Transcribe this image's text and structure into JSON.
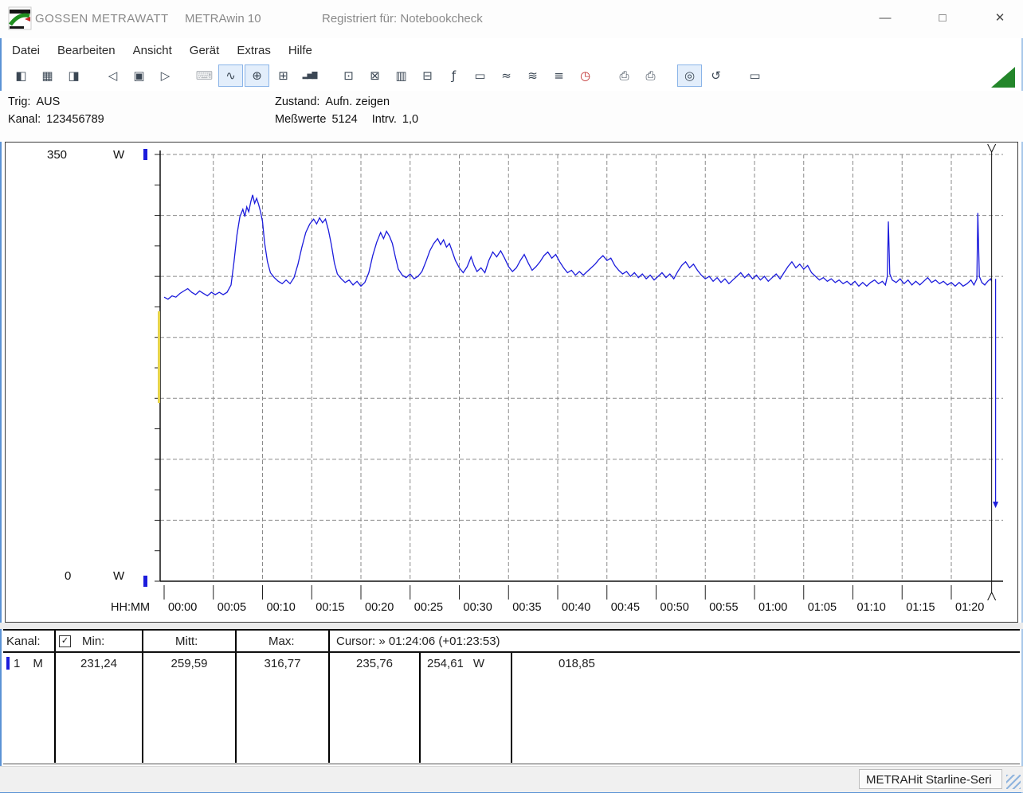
{
  "window": {
    "brand": "GOSSEN METRAWATT",
    "app": "METRAwin 10",
    "registration": "Registriert für: Notebookcheck",
    "controls": {
      "minimize": "—",
      "maximize": "□",
      "close": "✕"
    }
  },
  "menu": {
    "items": [
      {
        "id": "datei",
        "label": "Datei"
      },
      {
        "id": "bearbeiten",
        "label": "Bearbeiten"
      },
      {
        "id": "ansicht",
        "label": "Ansicht"
      },
      {
        "id": "geraet",
        "label": "Gerät"
      },
      {
        "id": "extras",
        "label": "Extras"
      },
      {
        "id": "hilfe",
        "label": "Hilfe"
      }
    ]
  },
  "toolbar": {
    "groups": [
      [
        {
          "name": "open-measurement-button",
          "icon": "disk-import-icon",
          "glyph": "◧"
        },
        {
          "name": "save-measurement-button",
          "icon": "disk-save-icon",
          "glyph": "▦"
        },
        {
          "name": "open-file-button",
          "icon": "folder-open-icon",
          "glyph": "◨"
        }
      ],
      [
        {
          "name": "window-back-button",
          "icon": "window-arrow-left-icon",
          "glyph": "◁"
        },
        {
          "name": "window-copy-button",
          "icon": "window-icon",
          "glyph": "▣"
        },
        {
          "name": "window-forward-button",
          "icon": "window-arrow-right-icon",
          "glyph": "▷"
        }
      ],
      [
        {
          "name": "keyboard-entry-button",
          "icon": "keyboard-icon",
          "glyph": "⌨",
          "disabled": true
        },
        {
          "name": "yt-chart-button",
          "icon": "line-chart-icon",
          "glyph": "∿",
          "pressed": true
        },
        {
          "name": "xy-chart-button",
          "icon": "crosshair-chart-icon",
          "glyph": "⊕",
          "pressed": true
        },
        {
          "name": "table-view-button",
          "icon": "table-icon",
          "glyph": "⊞"
        },
        {
          "name": "histogram-view-button",
          "icon": "bar-chart-icon",
          "glyph": "▂▅▇",
          "small": true
        }
      ],
      [
        {
          "name": "device-connect-button",
          "icon": "monitor-icon",
          "glyph": "⊡"
        },
        {
          "name": "device-readout-button",
          "icon": "monitor-arrow-icon",
          "glyph": "⊠"
        },
        {
          "name": "digital-display-button",
          "icon": "seven-segment-icon",
          "glyph": "▥"
        },
        {
          "name": "monitor-curve-button",
          "icon": "monitor-wave-icon",
          "glyph": "⊟"
        },
        {
          "name": "formula-button",
          "icon": "fx-icon",
          "glyph": "ƒ"
        },
        {
          "name": "counter-display-button",
          "icon": "display-icon",
          "glyph": "▭"
        },
        {
          "name": "dual-channel-button",
          "icon": "dual-wave-icon",
          "glyph": "≈"
        },
        {
          "name": "envelope-curves-button",
          "icon": "multi-wave-icon",
          "glyph": "≋"
        },
        {
          "name": "value-list-button",
          "icon": "value-list-icon",
          "glyph": "≡"
        },
        {
          "name": "timer-button",
          "icon": "alarm-clock-icon",
          "glyph": "◷",
          "color": "#c03030"
        }
      ],
      [
        {
          "name": "print-chart-button",
          "icon": "printer-icon",
          "glyph": "⎙"
        },
        {
          "name": "print-report-button",
          "icon": "printer-settings-icon",
          "glyph": "⎙"
        }
      ],
      [
        {
          "name": "zoom-curve-button",
          "icon": "magnifier-wave-icon",
          "glyph": "◎",
          "pressed": true
        },
        {
          "name": "zoom-reset-button",
          "icon": "magnifier-undo-icon",
          "glyph": "↺"
        }
      ],
      [
        {
          "name": "annotation-button",
          "icon": "callout-icon",
          "glyph": "▭"
        }
      ]
    ]
  },
  "status_info": {
    "trig_label": "Trig:",
    "trig_value": "AUS",
    "kanal_label": "Kanal:",
    "kanal_value": "123456789",
    "zustand_label": "Zustand:",
    "zustand_value": "Aufn. zeigen",
    "messwerte_label": "Meßwerte",
    "messwerte_value": "5124",
    "interval_label": "Intrv.",
    "interval_value": "1,0"
  },
  "chart_data": {
    "type": "line",
    "title": "",
    "x_axis_label": "HH:MM",
    "y_axis": {
      "max_label": "350",
      "min_label": "0",
      "unit": "W"
    },
    "ylim": [
      0,
      350
    ],
    "y_tick_step": 25,
    "grid": {
      "on": true,
      "y_step": 50,
      "x_step_min": 5
    },
    "x_ticks": [
      "00:00",
      "00:05",
      "00:10",
      "00:15",
      "00:20",
      "00:25",
      "00:30",
      "00:35",
      "00:40",
      "00:45",
      "00:50",
      "00:55",
      "01:00",
      "01:05",
      "01:10",
      "01:15",
      "01:20"
    ],
    "cursor_time_min": 84.1,
    "cursor_label": "Cursor: » 01:24:06 (+01:23:53)",
    "end_drop": {
      "t": 84.5,
      "from": 248,
      "to": 60
    },
    "series": [
      {
        "name": "Kanal 1",
        "unit": "W",
        "color": "#1c1cdc",
        "min": 231.24,
        "mean": 259.59,
        "max": 316.77,
        "points": [
          [
            0,
            233
          ],
          [
            0.4,
            231.3
          ],
          [
            0.8,
            234
          ],
          [
            1.2,
            233
          ],
          [
            1.6,
            236
          ],
          [
            2,
            238
          ],
          [
            2.4,
            240
          ],
          [
            2.8,
            237
          ],
          [
            3.2,
            235
          ],
          [
            3.6,
            238
          ],
          [
            4,
            236
          ],
          [
            4.4,
            234
          ],
          [
            4.8,
            237
          ],
          [
            5.2,
            235
          ],
          [
            5.6,
            237
          ],
          [
            6,
            235
          ],
          [
            6.4,
            237
          ],
          [
            6.8,
            243
          ],
          [
            7.1,
            262
          ],
          [
            7.4,
            284
          ],
          [
            7.7,
            299
          ],
          [
            8,
            305
          ],
          [
            8.2,
            299
          ],
          [
            8.4,
            307
          ],
          [
            8.6,
            303
          ],
          [
            8.8,
            311
          ],
          [
            9,
            316.8
          ],
          [
            9.2,
            310
          ],
          [
            9.4,
            314
          ],
          [
            9.6,
            309
          ],
          [
            9.8,
            303
          ],
          [
            10,
            295
          ],
          [
            10.2,
            278
          ],
          [
            10.5,
            262
          ],
          [
            10.8,
            253
          ],
          [
            11.2,
            249
          ],
          [
            11.6,
            246
          ],
          [
            12,
            244
          ],
          [
            12.4,
            247
          ],
          [
            12.8,
            244
          ],
          [
            13.2,
            249
          ],
          [
            13.6,
            260
          ],
          [
            14,
            274
          ],
          [
            14.4,
            286
          ],
          [
            14.8,
            293
          ],
          [
            15.2,
            297
          ],
          [
            15.5,
            293
          ],
          [
            15.8,
            298
          ],
          [
            16.1,
            294
          ],
          [
            16.4,
            297
          ],
          [
            16.7,
            288
          ],
          [
            17,
            276
          ],
          [
            17.3,
            261
          ],
          [
            17.6,
            252
          ],
          [
            18,
            248
          ],
          [
            18.4,
            245
          ],
          [
            18.8,
            247
          ],
          [
            19.2,
            243
          ],
          [
            19.6,
            246
          ],
          [
            20,
            242
          ],
          [
            20.4,
            245
          ],
          [
            20.8,
            253
          ],
          [
            21.2,
            267
          ],
          [
            21.6,
            278
          ],
          [
            22,
            286
          ],
          [
            22.3,
            281
          ],
          [
            22.6,
            287
          ],
          [
            22.9,
            283
          ],
          [
            23.2,
            277
          ],
          [
            23.5,
            266
          ],
          [
            23.8,
            256
          ],
          [
            24.2,
            251
          ],
          [
            24.6,
            249
          ],
          [
            25,
            252
          ],
          [
            25.4,
            248
          ],
          [
            25.8,
            250
          ],
          [
            26.2,
            254
          ],
          [
            26.6,
            262
          ],
          [
            27,
            271
          ],
          [
            27.4,
            277
          ],
          [
            27.8,
            281
          ],
          [
            28.1,
            276
          ],
          [
            28.4,
            280
          ],
          [
            28.7,
            274
          ],
          [
            29,
            277
          ],
          [
            29.3,
            270
          ],
          [
            29.6,
            263
          ],
          [
            30,
            257
          ],
          [
            30.4,
            253
          ],
          [
            30.8,
            258
          ],
          [
            31.2,
            266
          ],
          [
            31.5,
            259
          ],
          [
            31.8,
            254
          ],
          [
            32.2,
            257
          ],
          [
            32.6,
            253
          ],
          [
            33,
            263
          ],
          [
            33.4,
            270
          ],
          [
            33.8,
            266
          ],
          [
            34.2,
            271
          ],
          [
            34.6,
            265
          ],
          [
            35,
            258
          ],
          [
            35.4,
            254
          ],
          [
            35.8,
            257
          ],
          [
            36.2,
            263
          ],
          [
            36.6,
            268
          ],
          [
            37,
            261
          ],
          [
            37.4,
            255
          ],
          [
            37.8,
            258
          ],
          [
            38.2,
            262
          ],
          [
            38.6,
            267
          ],
          [
            39,
            270
          ],
          [
            39.4,
            265
          ],
          [
            39.8,
            268
          ],
          [
            40.2,
            262
          ],
          [
            40.6,
            257
          ],
          [
            41,
            253
          ],
          [
            41.4,
            255
          ],
          [
            41.8,
            251
          ],
          [
            42.2,
            254
          ],
          [
            42.6,
            251
          ],
          [
            43,
            254
          ],
          [
            43.4,
            257
          ],
          [
            43.8,
            260
          ],
          [
            44.2,
            264
          ],
          [
            44.6,
            267
          ],
          [
            45,
            263
          ],
          [
            45.4,
            265
          ],
          [
            45.8,
            259
          ],
          [
            46.2,
            255
          ],
          [
            46.6,
            252
          ],
          [
            47,
            254
          ],
          [
            47.4,
            250
          ],
          [
            47.8,
            253
          ],
          [
            48.2,
            249
          ],
          [
            48.6,
            252
          ],
          [
            49,
            248
          ],
          [
            49.4,
            251
          ],
          [
            49.8,
            247
          ],
          [
            50.2,
            250
          ],
          [
            50.6,
            253
          ],
          [
            51,
            249
          ],
          [
            51.4,
            252
          ],
          [
            51.8,
            248
          ],
          [
            52.2,
            254
          ],
          [
            52.6,
            259
          ],
          [
            53,
            262
          ],
          [
            53.4,
            257
          ],
          [
            53.8,
            260
          ],
          [
            54.2,
            255
          ],
          [
            54.6,
            251
          ],
          [
            55,
            248
          ],
          [
            55.4,
            250
          ],
          [
            55.8,
            246
          ],
          [
            56.2,
            249
          ],
          [
            56.6,
            245
          ],
          [
            57,
            248
          ],
          [
            57.4,
            244
          ],
          [
            57.8,
            247
          ],
          [
            58.2,
            250
          ],
          [
            58.6,
            253
          ],
          [
            59,
            249
          ],
          [
            59.4,
            252
          ],
          [
            59.8,
            248
          ],
          [
            60.2,
            251
          ],
          [
            60.6,
            247
          ],
          [
            61,
            250
          ],
          [
            61.4,
            246
          ],
          [
            61.8,
            249
          ],
          [
            62.2,
            252
          ],
          [
            62.6,
            248
          ],
          [
            63,
            253
          ],
          [
            63.4,
            258
          ],
          [
            63.8,
            262
          ],
          [
            64.2,
            257
          ],
          [
            64.6,
            260
          ],
          [
            65,
            256
          ],
          [
            65.4,
            259
          ],
          [
            65.8,
            253
          ],
          [
            66.2,
            250
          ],
          [
            66.6,
            247
          ],
          [
            67,
            249
          ],
          [
            67.4,
            246
          ],
          [
            67.8,
            248
          ],
          [
            68.2,
            245
          ],
          [
            68.6,
            247
          ],
          [
            69,
            244
          ],
          [
            69.4,
            246
          ],
          [
            69.8,
            243
          ],
          [
            70.2,
            246
          ],
          [
            70.6,
            242
          ],
          [
            71,
            245
          ],
          [
            71.4,
            242
          ],
          [
            71.8,
            245
          ],
          [
            72.2,
            247
          ],
          [
            72.6,
            244
          ],
          [
            73,
            246
          ],
          [
            73.3,
            243
          ],
          [
            73.5,
            250
          ],
          [
            73.6,
            295
          ],
          [
            73.75,
            252
          ],
          [
            74,
            247
          ],
          [
            74.4,
            245
          ],
          [
            74.8,
            248
          ],
          [
            75.2,
            244
          ],
          [
            75.6,
            247
          ],
          [
            76,
            243
          ],
          [
            76.4,
            246
          ],
          [
            76.8,
            243
          ],
          [
            77.2,
            246
          ],
          [
            77.6,
            249
          ],
          [
            78,
            245
          ],
          [
            78.4,
            247
          ],
          [
            78.8,
            244
          ],
          [
            79.2,
            246
          ],
          [
            79.6,
            243
          ],
          [
            80,
            245
          ],
          [
            80.4,
            242
          ],
          [
            80.8,
            245
          ],
          [
            81.2,
            242
          ],
          [
            81.6,
            244
          ],
          [
            82,
            247
          ],
          [
            82.3,
            243
          ],
          [
            82.6,
            248
          ],
          [
            82.7,
            302
          ],
          [
            82.85,
            250
          ],
          [
            83.1,
            245
          ],
          [
            83.4,
            243
          ],
          [
            83.7,
            246
          ],
          [
            84,
            248
          ],
          [
            84.1,
            246
          ]
        ]
      }
    ]
  },
  "channel_table": {
    "header": {
      "kanal_label": "Kanal:",
      "checkbox_checked": true,
      "checkbox_glyph": "✓",
      "min_label": "Min:",
      "mitt_label": "Mitt:",
      "max_label": "Max:",
      "cursor_label": "Cursor: » 01:24:06 (+01:23:53)"
    },
    "rows": [
      {
        "channel": "1",
        "mode": "M",
        "min": "231,24",
        "mitt": "259,59",
        "max": "316,77",
        "cursor_a": "235,76",
        "cursor_b": "254,61",
        "unit": "W",
        "delta": "018,85"
      }
    ]
  },
  "status_bar": {
    "device": "METRAHit Starline-Seri"
  }
}
